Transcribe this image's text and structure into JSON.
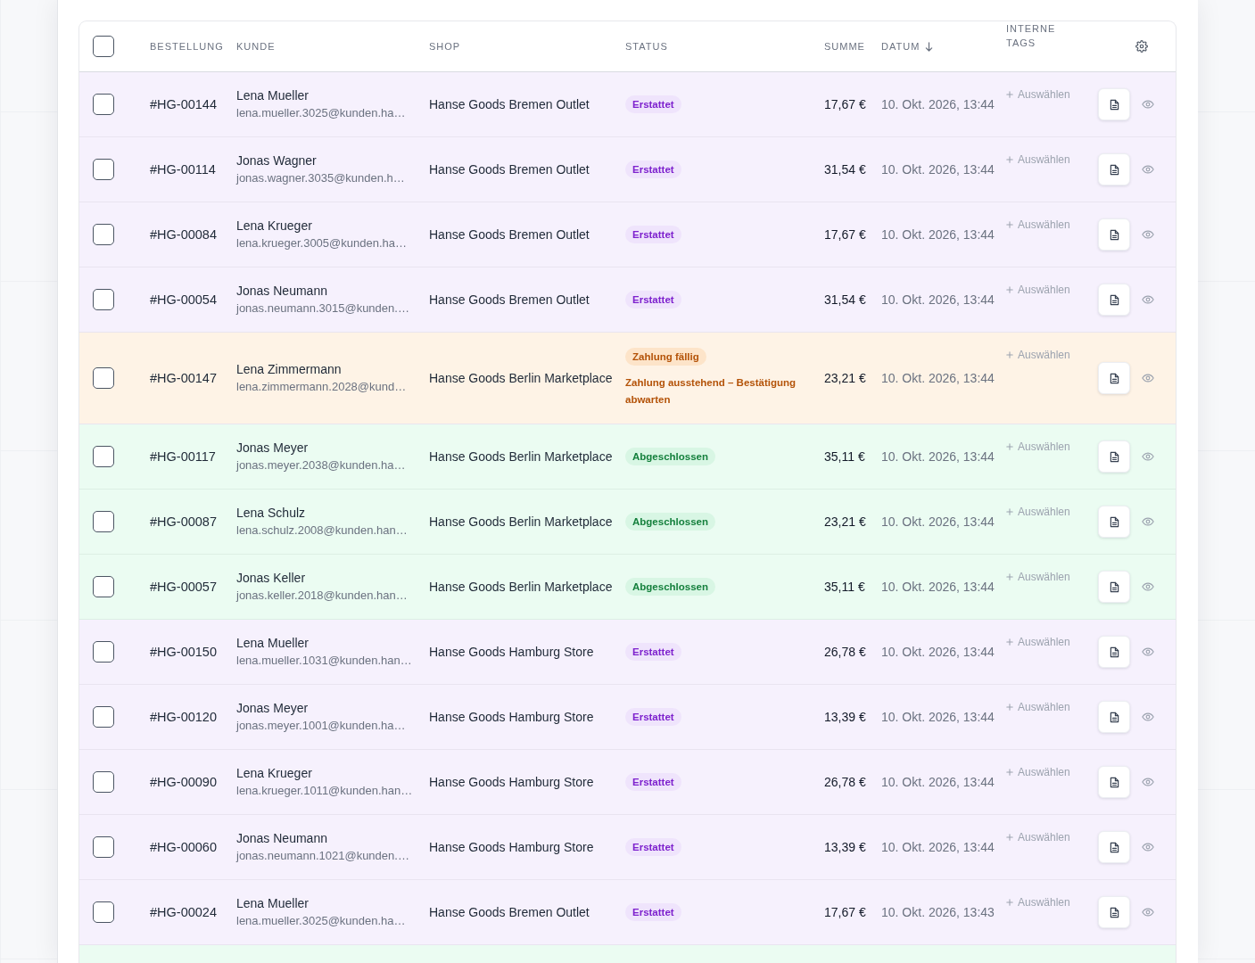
{
  "table": {
    "select_all": {
      "checked": false
    },
    "columns": [
      {
        "label": "BESTELLUNG",
        "sorted_descending": false
      },
      {
        "label": "KUNDE",
        "sorted_descending": false
      },
      {
        "label": "SHOP",
        "sorted_descending": false
      },
      {
        "label": "STATUS",
        "sorted_descending": false
      },
      {
        "label": "SUMME",
        "sorted_descending": false
      },
      {
        "label": "DATUM",
        "sorted_descending": true
      },
      {
        "label": "INTERNE TAGS",
        "sorted_descending": false
      }
    ],
    "rows": [
      {
        "checked": false,
        "order": "#HG-00144",
        "customer": {
          "name": "Lena Mueller",
          "email": "lena.mueller.3025@kunden.ha…"
        },
        "shop": "Hanse Goods Bremen Outlet",
        "status": {
          "kind": "refunded",
          "label": "Erstattet"
        },
        "total": "17,67 €",
        "date": "10. Okt. 2026, 13:44",
        "tags_action": "Auswählen"
      },
      {
        "checked": false,
        "order": "#HG-00114",
        "customer": {
          "name": "Jonas Wagner",
          "email": "jonas.wagner.3035@kunden.h…"
        },
        "shop": "Hanse Goods Bremen Outlet",
        "status": {
          "kind": "refunded",
          "label": "Erstattet"
        },
        "total": "31,54 €",
        "date": "10. Okt. 2026, 13:44",
        "tags_action": "Auswählen"
      },
      {
        "checked": false,
        "order": "#HG-00084",
        "customer": {
          "name": "Lena Krueger",
          "email": "lena.krueger.3005@kunden.ha…"
        },
        "shop": "Hanse Goods Bremen Outlet",
        "status": {
          "kind": "refunded",
          "label": "Erstattet"
        },
        "total": "17,67 €",
        "date": "10. Okt. 2026, 13:44",
        "tags_action": "Auswählen"
      },
      {
        "checked": false,
        "order": "#HG-00054",
        "customer": {
          "name": "Jonas Neumann",
          "email": "jonas.neumann.3015@kunden.…"
        },
        "shop": "Hanse Goods Bremen Outlet",
        "status": {
          "kind": "refunded",
          "label": "Erstattet"
        },
        "total": "31,54 €",
        "date": "10. Okt. 2026, 13:44",
        "tags_action": "Auswählen"
      },
      {
        "checked": false,
        "order": "#HG-00147",
        "customer": {
          "name": "Lena Zimmermann",
          "email": "lena.zimmermann.2028@kund…"
        },
        "shop": "Hanse Goods Berlin Marketplace",
        "status": {
          "kind": "payment_due",
          "label": "Zahlung fällig",
          "note": "Zahlung ausstehend – Bestätigung abwarten"
        },
        "total": "23,21 €",
        "date": "10. Okt. 2026, 13:44",
        "tags_action": "Auswählen"
      },
      {
        "checked": false,
        "order": "#HG-00117",
        "customer": {
          "name": "Jonas Meyer",
          "email": "jonas.meyer.2038@kunden.ha…"
        },
        "shop": "Hanse Goods Berlin Marketplace",
        "status": {
          "kind": "completed",
          "label": "Abgeschlossen"
        },
        "total": "35,11 €",
        "date": "10. Okt. 2026, 13:44",
        "tags_action": "Auswählen"
      },
      {
        "checked": false,
        "order": "#HG-00087",
        "customer": {
          "name": "Lena Schulz",
          "email": "lena.schulz.2008@kunden.han…"
        },
        "shop": "Hanse Goods Berlin Marketplace",
        "status": {
          "kind": "completed",
          "label": "Abgeschlossen"
        },
        "total": "23,21 €",
        "date": "10. Okt. 2026, 13:44",
        "tags_action": "Auswählen"
      },
      {
        "checked": false,
        "order": "#HG-00057",
        "customer": {
          "name": "Jonas Keller",
          "email": "jonas.keller.2018@kunden.han…"
        },
        "shop": "Hanse Goods Berlin Marketplace",
        "status": {
          "kind": "completed",
          "label": "Abgeschlossen"
        },
        "total": "35,11 €",
        "date": "10. Okt. 2026, 13:44",
        "tags_action": "Auswählen"
      },
      {
        "checked": false,
        "order": "#HG-00150",
        "customer": {
          "name": "Lena Mueller",
          "email": "lena.mueller.1031@kunden.han…"
        },
        "shop": "Hanse Goods Hamburg Store",
        "status": {
          "kind": "refunded",
          "label": "Erstattet"
        },
        "total": "26,78 €",
        "date": "10. Okt. 2026, 13:44",
        "tags_action": "Auswählen"
      },
      {
        "checked": false,
        "order": "#HG-00120",
        "customer": {
          "name": "Jonas Meyer",
          "email": "jonas.meyer.1001@kunden.ha…"
        },
        "shop": "Hanse Goods Hamburg Store",
        "status": {
          "kind": "refunded",
          "label": "Erstattet"
        },
        "total": "13,39 €",
        "date": "10. Okt. 2026, 13:44",
        "tags_action": "Auswählen"
      },
      {
        "checked": false,
        "order": "#HG-00090",
        "customer": {
          "name": "Lena Krueger",
          "email": "lena.krueger.1011@kunden.han…"
        },
        "shop": "Hanse Goods Hamburg Store",
        "status": {
          "kind": "refunded",
          "label": "Erstattet"
        },
        "total": "26,78 €",
        "date": "10. Okt. 2026, 13:44",
        "tags_action": "Auswählen"
      },
      {
        "checked": false,
        "order": "#HG-00060",
        "customer": {
          "name": "Jonas Neumann",
          "email": "jonas.neumann.1021@kunden.…"
        },
        "shop": "Hanse Goods Hamburg Store",
        "status": {
          "kind": "refunded",
          "label": "Erstattet"
        },
        "total": "13,39 €",
        "date": "10. Okt. 2026, 13:44",
        "tags_action": "Auswählen"
      },
      {
        "checked": false,
        "order": "#HG-00024",
        "customer": {
          "name": "Lena Mueller",
          "email": "lena.mueller.3025@kunden.ha…"
        },
        "shop": "Hanse Goods Bremen Outlet",
        "status": {
          "kind": "refunded",
          "label": "Erstattet"
        },
        "total": "17,67 €",
        "date": "10. Okt. 2026, 13:43",
        "tags_action": "Auswählen"
      }
    ],
    "partial_row": {
      "kind": "completed"
    }
  }
}
